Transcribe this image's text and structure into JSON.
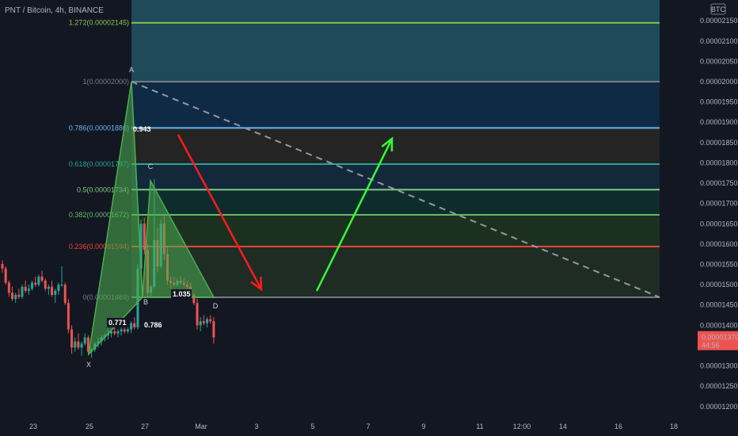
{
  "header": {
    "title": "PNT / Bitcoin, 4h, BINANCE"
  },
  "price_axis": {
    "currency_badge": "BTC",
    "labels": [
      "0.00002150",
      "0.00002100",
      "0.00002050",
      "0.00002000",
      "0.00001950",
      "0.00001900",
      "0.00001850",
      "0.00001800",
      "0.00001750",
      "0.00001700",
      "0.00001650",
      "0.00001600",
      "0.00001550",
      "0.00001500",
      "0.00001450",
      "0.00001400",
      "0.00001350",
      "0.00001300",
      "0.00001250",
      "0.00001200"
    ],
    "current_price": "0.00001370",
    "countdown": "44:56"
  },
  "colors": {
    "bg": "#131722",
    "up": "#26a69a",
    "down": "#ef5350",
    "pattern_fill": "#4caf50",
    "red_arrow": "#ff1a1a",
    "green_arrow": "#33ff33",
    "price_badge": "#ef5350"
  },
  "chart_data": {
    "type": "candlestick",
    "symbol": "PNT / Bitcoin",
    "interval": "4h",
    "exchange": "BINANCE",
    "x_ticks": [
      "23",
      "25",
      "27",
      "Mar",
      "3",
      "5",
      "7",
      "9",
      "11",
      "12:00",
      "14",
      "16",
      "18"
    ],
    "y_range": [
      1.18e-05,
      2.19e-05
    ],
    "fib_levels": [
      {
        "ratio": "1.272",
        "price": 2.145e-05,
        "label": "1.272(0.00002145)",
        "color": "#8bc34a",
        "band": "#1e4a5a"
      },
      {
        "ratio": "1",
        "price": 2e-05,
        "label": "1(0.00002000)",
        "color": "#787b86",
        "band": "#0f2a44"
      },
      {
        "ratio": "0.786",
        "price": 1.886e-05,
        "label": "0.786(0.00001886)",
        "color": "#64b5f6",
        "band": "#242424"
      },
      {
        "ratio": "0.618",
        "price": 1.797e-05,
        "label": "0.618(0.00001797)",
        "color": "#26a69a",
        "band": "#14283c"
      },
      {
        "ratio": "0.5",
        "price": 1.734e-05,
        "label": "0.5(0.00001734)",
        "color": "#81c784",
        "band": "#0f2c2c"
      },
      {
        "ratio": "0.382",
        "price": 1.672e-05,
        "label": "0.382(0.00001672)",
        "color": "#66bb6a",
        "band": "#1c3020"
      },
      {
        "ratio": "0.236",
        "price": 1.594e-05,
        "label": "0.236(0.00001594)",
        "color": "#f44336",
        "band": "#1e2c24"
      },
      {
        "ratio": "0",
        "price": 1.469e-05,
        "label": "0(0.00001469)",
        "color": "#787b86",
        "band": "#3a1414"
      }
    ],
    "pattern_points": [
      {
        "name": "X",
        "price": 1.33e-05
      },
      {
        "name": "A",
        "price": 2e-05
      },
      {
        "name": "B",
        "price": 1.47e-05
      },
      {
        "name": "C",
        "price": 1.76e-05
      },
      {
        "name": "D",
        "price": 1.47e-05
      }
    ],
    "pattern_ratios": [
      {
        "label": "0.771"
      },
      {
        "label": "0.786"
      },
      {
        "label": "0.943"
      },
      {
        "label": "1.035"
      }
    ],
    "candles": [
      {
        "o": 1.551,
        "h": 1.56,
        "l": 1.53,
        "c": 1.54
      },
      {
        "o": 1.54,
        "h": 1.545,
        "l": 1.5,
        "c": 1.505
      },
      {
        "o": 1.505,
        "h": 1.51,
        "l": 1.47,
        "c": 1.48
      },
      {
        "o": 1.48,
        "h": 1.495,
        "l": 1.46,
        "c": 1.465
      },
      {
        "o": 1.465,
        "h": 1.48,
        "l": 1.455,
        "c": 1.475
      },
      {
        "o": 1.475,
        "h": 1.49,
        "l": 1.465,
        "c": 1.47
      },
      {
        "o": 1.47,
        "h": 1.5,
        "l": 1.465,
        "c": 1.495
      },
      {
        "o": 1.495,
        "h": 1.51,
        "l": 1.48,
        "c": 1.485
      },
      {
        "o": 1.485,
        "h": 1.5,
        "l": 1.475,
        "c": 1.49
      },
      {
        "o": 1.49,
        "h": 1.51,
        "l": 1.485,
        "c": 1.505
      },
      {
        "o": 1.505,
        "h": 1.52,
        "l": 1.495,
        "c": 1.5
      },
      {
        "o": 1.5,
        "h": 1.525,
        "l": 1.495,
        "c": 1.52
      },
      {
        "o": 1.52,
        "h": 1.535,
        "l": 1.505,
        "c": 1.51
      },
      {
        "o": 1.51,
        "h": 1.515,
        "l": 1.485,
        "c": 1.49
      },
      {
        "o": 1.49,
        "h": 1.5,
        "l": 1.475,
        "c": 1.495
      },
      {
        "o": 1.495,
        "h": 1.51,
        "l": 1.47,
        "c": 1.475
      },
      {
        "o": 1.475,
        "h": 1.49,
        "l": 1.455,
        "c": 1.485
      },
      {
        "o": 1.485,
        "h": 1.505,
        "l": 1.475,
        "c": 1.5
      },
      {
        "o": 1.5,
        "h": 1.545,
        "l": 1.495,
        "c": 1.5
      },
      {
        "o": 1.5,
        "h": 1.505,
        "l": 1.45,
        "c": 1.455
      },
      {
        "o": 1.455,
        "h": 1.465,
        "l": 1.38,
        "c": 1.39
      },
      {
        "o": 1.39,
        "h": 1.4,
        "l": 1.33,
        "c": 1.345
      },
      {
        "o": 1.345,
        "h": 1.37,
        "l": 1.335,
        "c": 1.36
      },
      {
        "o": 1.36,
        "h": 1.38,
        "l": 1.34,
        "c": 1.345
      },
      {
        "o": 1.345,
        "h": 1.36,
        "l": 1.325,
        "c": 1.355
      },
      {
        "o": 1.355,
        "h": 1.38,
        "l": 1.35,
        "c": 1.37
      },
      {
        "o": 1.37,
        "h": 1.375,
        "l": 1.33,
        "c": 1.335
      },
      {
        "o": 1.335,
        "h": 1.345,
        "l": 1.32,
        "c": 1.34
      },
      {
        "o": 1.34,
        "h": 1.36,
        "l": 1.335,
        "c": 1.355
      },
      {
        "o": 1.355,
        "h": 1.37,
        "l": 1.345,
        "c": 1.36
      },
      {
        "o": 1.36,
        "h": 1.375,
        "l": 1.35,
        "c": 1.37
      },
      {
        "o": 1.37,
        "h": 1.38,
        "l": 1.36,
        "c": 1.375
      },
      {
        "o": 1.375,
        "h": 1.39,
        "l": 1.365,
        "c": 1.38
      },
      {
        "o": 1.38,
        "h": 1.39,
        "l": 1.37,
        "c": 1.385
      },
      {
        "o": 1.385,
        "h": 1.395,
        "l": 1.375,
        "c": 1.38
      },
      {
        "o": 1.38,
        "h": 1.39,
        "l": 1.37,
        "c": 1.385
      },
      {
        "o": 1.385,
        "h": 1.395,
        "l": 1.375,
        "c": 1.39
      },
      {
        "o": 1.39,
        "h": 1.4,
        "l": 1.38,
        "c": 1.385
      },
      {
        "o": 1.385,
        "h": 1.395,
        "l": 1.38,
        "c": 1.39
      },
      {
        "o": 1.39,
        "h": 1.41,
        "l": 1.38,
        "c": 1.405
      },
      {
        "o": 1.405,
        "h": 1.42,
        "l": 1.39,
        "c": 1.395
      },
      {
        "o": 1.395,
        "h": 1.55,
        "l": 1.39,
        "c": 1.54
      },
      {
        "o": 1.54,
        "h": 1.66,
        "l": 1.52,
        "c": 1.65
      },
      {
        "o": 1.65,
        "h": 1.665,
        "l": 1.575,
        "c": 1.585
      },
      {
        "o": 1.585,
        "h": 1.6,
        "l": 1.47,
        "c": 1.48
      },
      {
        "o": 1.48,
        "h": 1.5,
        "l": 1.47,
        "c": 1.495
      },
      {
        "o": 1.495,
        "h": 1.76,
        "l": 1.49,
        "c": 1.61
      },
      {
        "o": 1.61,
        "h": 1.64,
        "l": 1.53,
        "c": 1.545
      },
      {
        "o": 1.545,
        "h": 1.66,
        "l": 1.54,
        "c": 1.65
      },
      {
        "o": 1.65,
        "h": 1.67,
        "l": 1.56,
        "c": 1.575
      },
      {
        "o": 1.575,
        "h": 1.595,
        "l": 1.5,
        "c": 1.51
      },
      {
        "o": 1.51,
        "h": 1.52,
        "l": 1.49,
        "c": 1.505
      },
      {
        "o": 1.505,
        "h": 1.52,
        "l": 1.495,
        "c": 1.5
      },
      {
        "o": 1.5,
        "h": 1.515,
        "l": 1.495,
        "c": 1.51
      },
      {
        "o": 1.51,
        "h": 1.52,
        "l": 1.5,
        "c": 1.505
      },
      {
        "o": 1.505,
        "h": 1.515,
        "l": 1.495,
        "c": 1.5
      },
      {
        "o": 1.5,
        "h": 1.51,
        "l": 1.49,
        "c": 1.495
      },
      {
        "o": 1.495,
        "h": 1.505,
        "l": 1.47,
        "c": 1.475
      },
      {
        "o": 1.475,
        "h": 1.48,
        "l": 1.45,
        "c": 1.455
      },
      {
        "o": 1.455,
        "h": 1.465,
        "l": 1.39,
        "c": 1.4
      },
      {
        "o": 1.4,
        "h": 1.42,
        "l": 1.385,
        "c": 1.41
      },
      {
        "o": 1.41,
        "h": 1.425,
        "l": 1.4,
        "c": 1.405
      },
      {
        "o": 1.405,
        "h": 1.42,
        "l": 1.395,
        "c": 1.415
      },
      {
        "o": 1.415,
        "h": 1.425,
        "l": 1.405,
        "c": 1.41
      },
      {
        "o": 1.41,
        "h": 1.42,
        "l": 1.355,
        "c": 1.37
      }
    ],
    "candle_scale": "values x 0.00001 BTC"
  }
}
